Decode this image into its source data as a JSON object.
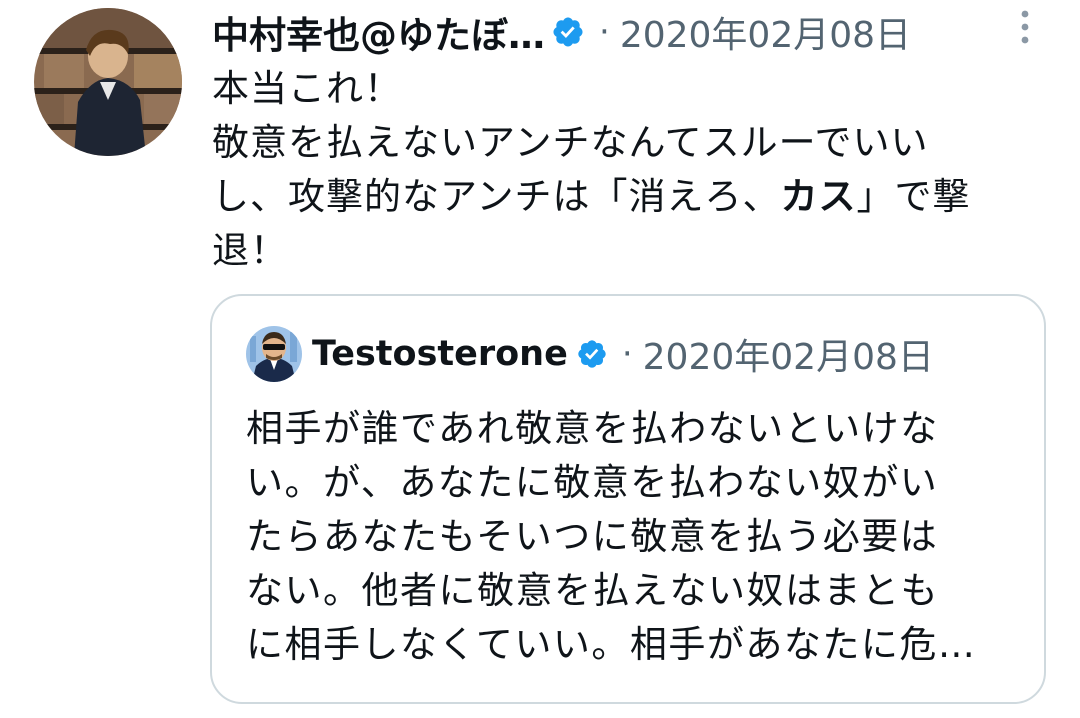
{
  "tweet": {
    "author_name": "中村幸也@ゆたぼ…",
    "date": "2020年02月08日",
    "separator": "·",
    "verified_icon": "verified-badge-icon",
    "more_icon": "more-vertical-icon",
    "text_lines": [
      {
        "parts": [
          {
            "text": "本当これ！"
          }
        ]
      },
      {
        "parts": [
          {
            "text": "敬意を払えないアンチなんてスルーでいい"
          }
        ]
      },
      {
        "parts": [
          {
            "text": "し、攻撃的なアンチは「消えろ、"
          },
          {
            "text": "カス",
            "bold": true
          },
          {
            "text": "」で撃"
          }
        ]
      },
      {
        "parts": [
          {
            "text": "退！"
          }
        ]
      }
    ]
  },
  "quoted_tweet": {
    "author_name": "Testosterone",
    "date": "2020年02月08日",
    "separator": "·",
    "verified_icon": "verified-badge-icon",
    "text_lines": [
      "相手が誰であれ敬意を払わないといけな",
      "い。が、あなたに敬意を払わない奴がい",
      "たらあなたもそいつに敬意を払う必要は",
      "ない。他者に敬意を払えない奴はまとも",
      "に相手しなくていい。相手があなたに危…"
    ]
  },
  "colors": {
    "text": "#0f1419",
    "secondary": "#536471",
    "verified": "#1d9bf0",
    "border": "#cfd9de"
  }
}
